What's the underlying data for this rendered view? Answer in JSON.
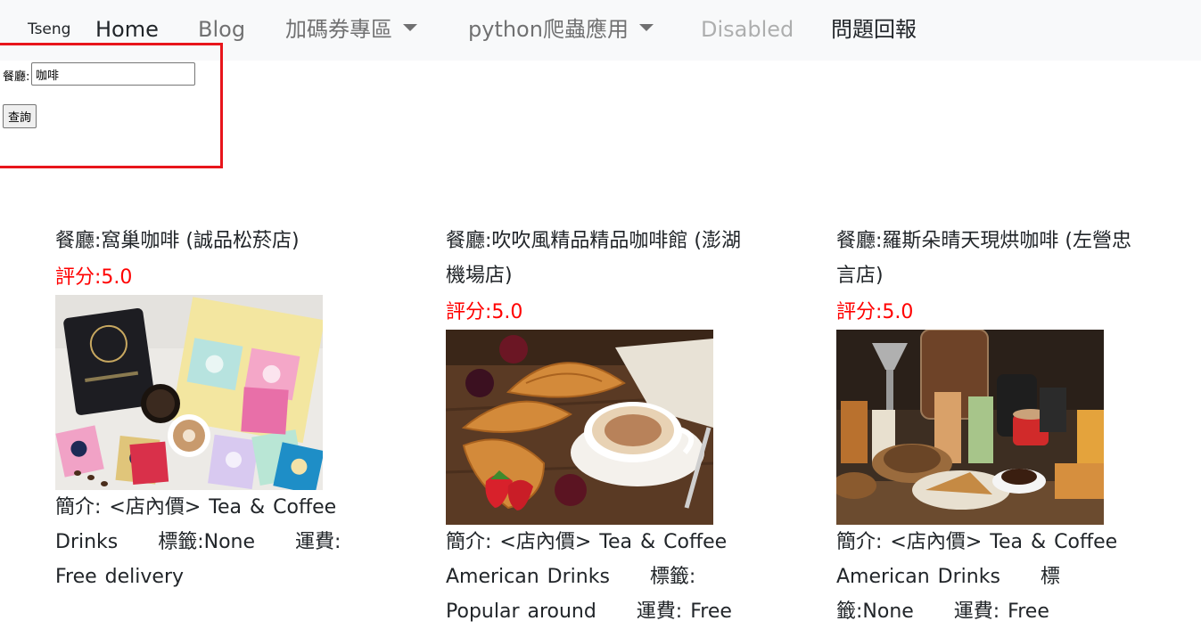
{
  "navbar": {
    "brand": "Tseng",
    "items": [
      {
        "label": "Home"
      },
      {
        "label": "Blog"
      },
      {
        "label": "加碼券專區"
      },
      {
        "label": "python爬蟲應用"
      },
      {
        "label": "Disabled"
      },
      {
        "label": "問題回報"
      }
    ]
  },
  "search": {
    "label": "餐廳:",
    "value": "咖啡",
    "button_label": "查詢"
  },
  "cards": [
    {
      "name": "餐廳:窩巢咖啡 (誠品松菸店)",
      "rating": "評分:5.0",
      "description": "簡介: <店內價> Tea & Coffee Drinks     標籤:None     運費: Free delivery"
    },
    {
      "name": "餐廳:吹吹風精品精品咖啡館 (澎湖機場店)",
      "rating": "評分:5.0",
      "description": "簡介: <店內價> Tea & Coffee American Drinks     標籤: Popular around     運費: Free"
    },
    {
      "name": "餐廳:羅斯朵晴天現烘咖啡 (左營忠言店)",
      "rating": "評分:5.0",
      "description": "簡介: <店內價> Tea & Coffee American Drinks     標籤:None     運費: Free"
    }
  ],
  "colors": {
    "navbar_bg": "#f8f9fa",
    "highlight_border": "#e8151b",
    "rating": "#ff0000"
  }
}
